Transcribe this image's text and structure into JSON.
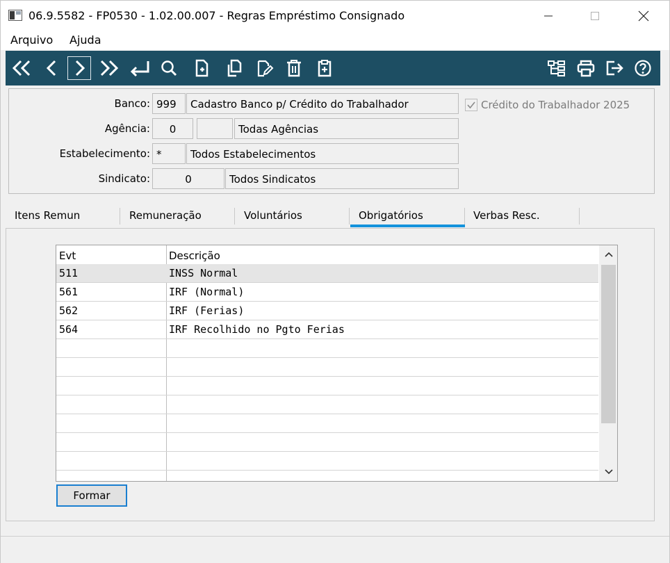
{
  "window": {
    "title": "06.9.5582 - FP0530 - 1.02.00.007 - Regras Empréstimo Consignado",
    "minimize_glyph": "—",
    "maximize_glyph": "☐",
    "close_glyph": "✕"
  },
  "menu": {
    "items": [
      "Arquivo",
      "Ajuda"
    ]
  },
  "toolbar": {
    "accent": "#1d4e63",
    "left_icons": [
      "first-record-icon",
      "previous-record-icon",
      "next-record-icon",
      "last-record-icon",
      "return-icon",
      "search-icon",
      "new-record-icon",
      "copy-record-icon",
      "edit-record-icon",
      "delete-icon",
      "paste-icon"
    ],
    "right_icons": [
      "hierarchy-icon",
      "print-icon",
      "exit-icon",
      "help-icon"
    ]
  },
  "header": {
    "banco_label": "Banco:",
    "banco_code": "999",
    "banco_desc": "Cadastro Banco p/ Crédito do Trabalhador",
    "agencia_label": "Agência:",
    "agencia_code": "0",
    "agencia_extra": "",
    "agencia_desc": "Todas Agências",
    "estab_label": "Estabelecimento:",
    "estab_code": "*",
    "estab_desc": "Todos Estabelecimentos",
    "sindicato_label": "Sindicato:",
    "sindicato_code": "0",
    "sindicato_desc": "Todos Sindicatos",
    "credito_label": "Crédito do Trabalhador 2025",
    "credito_checked": true
  },
  "tabs": {
    "items": [
      "Itens Remun",
      "Remuneração",
      "Voluntários",
      "Obrigatórios",
      "Verbas Resc."
    ],
    "active": "Obrigatórios",
    "active_color": "#1493dc"
  },
  "grid": {
    "columns": [
      "Evt",
      "Descrição"
    ],
    "rows": [
      {
        "evt": "511",
        "desc": "INSS Normal"
      },
      {
        "evt": "561",
        "desc": "IRF (Normal)"
      },
      {
        "evt": "562",
        "desc": "IRF (Ferias)"
      },
      {
        "evt": "564",
        "desc": "IRF Recolhido no Pgto Ferias"
      },
      {
        "evt": "",
        "desc": ""
      },
      {
        "evt": "",
        "desc": ""
      },
      {
        "evt": "",
        "desc": ""
      },
      {
        "evt": "",
        "desc": ""
      },
      {
        "evt": "",
        "desc": ""
      },
      {
        "evt": "",
        "desc": ""
      },
      {
        "evt": "",
        "desc": ""
      },
      {
        "evt": "",
        "desc": ""
      }
    ],
    "selected_index": 0
  },
  "buttons": {
    "formar": "Formar"
  }
}
